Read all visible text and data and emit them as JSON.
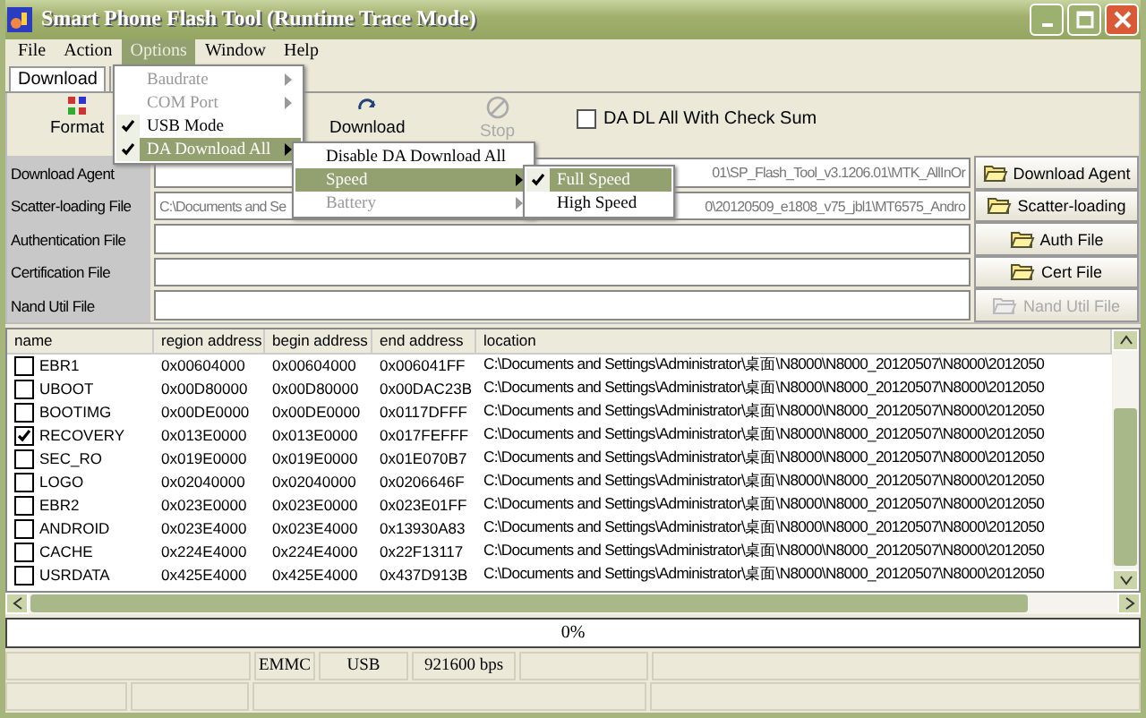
{
  "window": {
    "title": "Smart Phone Flash Tool (Runtime Trace Mode)"
  },
  "menu_bar": [
    {
      "label": "File",
      "selected": false
    },
    {
      "label": "Action",
      "selected": false
    },
    {
      "label": "Options",
      "selected": true
    },
    {
      "label": "Window",
      "selected": false
    },
    {
      "label": "Help",
      "selected": false
    }
  ],
  "tabs": [
    {
      "label": "Download",
      "selected": true
    }
  ],
  "toolbar": [
    {
      "label": "Format",
      "kind": "format",
      "disabled": false
    },
    {
      "label": "Download",
      "kind": "download",
      "disabled": false
    },
    {
      "label": "Stop",
      "kind": "stop",
      "disabled": true
    }
  ],
  "check_sum": {
    "label": "DA DL All With Check Sum",
    "checked": false
  },
  "file_rows": [
    {
      "label": "Download Agent",
      "value_start": "",
      "value_end": "01\\SP_Flash_Tool_v3.1206.01\\MTK_AllInOr",
      "button": "Download Agent",
      "disabled": false
    },
    {
      "label": "Scatter-loading File",
      "value_start": "C:\\Documents and Se",
      "value_end": "0\\20120509_e1808_v75_jbl1\\MT6575_Andro",
      "button": "Scatter-loading",
      "disabled": false
    },
    {
      "label": "Authentication File",
      "value_start": "",
      "value_end": "",
      "button": "Auth File",
      "disabled": false
    },
    {
      "label": "Certification File",
      "value_start": "",
      "value_end": "",
      "button": "Cert File",
      "disabled": false
    },
    {
      "label": "Nand Util File",
      "value_start": "",
      "value_end": "",
      "button": "Nand Util File",
      "disabled": true
    }
  ],
  "table": {
    "columns": [
      "name",
      "region address",
      "begin address",
      "end address",
      "location"
    ],
    "rows": [
      {
        "name": "EBR1",
        "region": "0x00604000",
        "begin": "0x00604000",
        "end": "0x006041FF",
        "location": "C:\\Documents and Settings\\Administrator\\桌面\\N8000\\N8000_20120507\\N8000\\2012050",
        "checked": false
      },
      {
        "name": "UBOOT",
        "region": "0x00D80000",
        "begin": "0x00D80000",
        "end": "0x00DAC23B",
        "location": "C:\\Documents and Settings\\Administrator\\桌面\\N8000\\N8000_20120507\\N8000\\2012050",
        "checked": false
      },
      {
        "name": "BOOTIMG",
        "region": "0x00DE0000",
        "begin": "0x00DE0000",
        "end": "0x0117DFFF",
        "location": "C:\\Documents and Settings\\Administrator\\桌面\\N8000\\N8000_20120507\\N8000\\2012050",
        "checked": false
      },
      {
        "name": "RECOVERY",
        "region": "0x013E0000",
        "begin": "0x013E0000",
        "end": "0x017FEFFF",
        "location": "C:\\Documents and Settings\\Administrator\\桌面\\N8000\\N8000_20120507\\N8000\\2012050",
        "checked": true
      },
      {
        "name": "SEC_RO",
        "region": "0x019E0000",
        "begin": "0x019E0000",
        "end": "0x01E070B7",
        "location": "C:\\Documents and Settings\\Administrator\\桌面\\N8000\\N8000_20120507\\N8000\\2012050",
        "checked": false
      },
      {
        "name": "LOGO",
        "region": "0x02040000",
        "begin": "0x02040000",
        "end": "0x0206646F",
        "location": "C:\\Documents and Settings\\Administrator\\桌面\\N8000\\N8000_20120507\\N8000\\2012050",
        "checked": false
      },
      {
        "name": "EBR2",
        "region": "0x023E0000",
        "begin": "0x023E0000",
        "end": "0x023E01FF",
        "location": "C:\\Documents and Settings\\Administrator\\桌面\\N8000\\N8000_20120507\\N8000\\2012050",
        "checked": false
      },
      {
        "name": "ANDROID",
        "region": "0x023E4000",
        "begin": "0x023E4000",
        "end": "0x13930A83",
        "location": "C:\\Documents and Settings\\Administrator\\桌面\\N8000\\N8000_20120507\\N8000\\2012050",
        "checked": false
      },
      {
        "name": "CACHE",
        "region": "0x224E4000",
        "begin": "0x224E4000",
        "end": "0x22F13117",
        "location": "C:\\Documents and Settings\\Administrator\\桌面\\N8000\\N8000_20120507\\N8000\\2012050",
        "checked": false
      },
      {
        "name": "USRDATA",
        "region": "0x425E4000",
        "begin": "0x425E4000",
        "end": "0x437D913B",
        "location": "C:\\Documents and Settings\\Administrator\\桌面\\N8000\\N8000_20120507\\N8000\\2012050",
        "checked": false
      }
    ]
  },
  "progress": {
    "label": "0%",
    "level": 0
  },
  "status_bar": [
    "EMMC",
    "USB",
    "921600 bps"
  ],
  "open_menus": [
    {
      "items": [
        {
          "label": "Baudrate",
          "disabled": true,
          "checked": false,
          "selected": false,
          "submenu": true
        },
        {
          "label": "COM Port",
          "disabled": true,
          "checked": false,
          "selected": false,
          "submenu": true
        },
        {
          "label": "USB Mode",
          "disabled": false,
          "checked": true,
          "selected": false,
          "submenu": false
        },
        {
          "label": "DA Download All",
          "disabled": false,
          "checked": true,
          "selected": true,
          "submenu": true
        }
      ]
    },
    {
      "items": [
        {
          "label": "Disable DA Download All",
          "disabled": false,
          "checked": false,
          "selected": false,
          "submenu": false
        },
        {
          "label": "Speed",
          "disabled": false,
          "checked": false,
          "selected": true,
          "submenu": true
        },
        {
          "label": "Battery",
          "disabled": true,
          "checked": false,
          "selected": false,
          "submenu": true
        }
      ]
    },
    {
      "items": [
        {
          "label": "Full Speed",
          "disabled": false,
          "checked": true,
          "selected": true,
          "submenu": false
        },
        {
          "label": "High Speed",
          "disabled": false,
          "checked": false,
          "selected": false,
          "submenu": false
        }
      ]
    }
  ]
}
